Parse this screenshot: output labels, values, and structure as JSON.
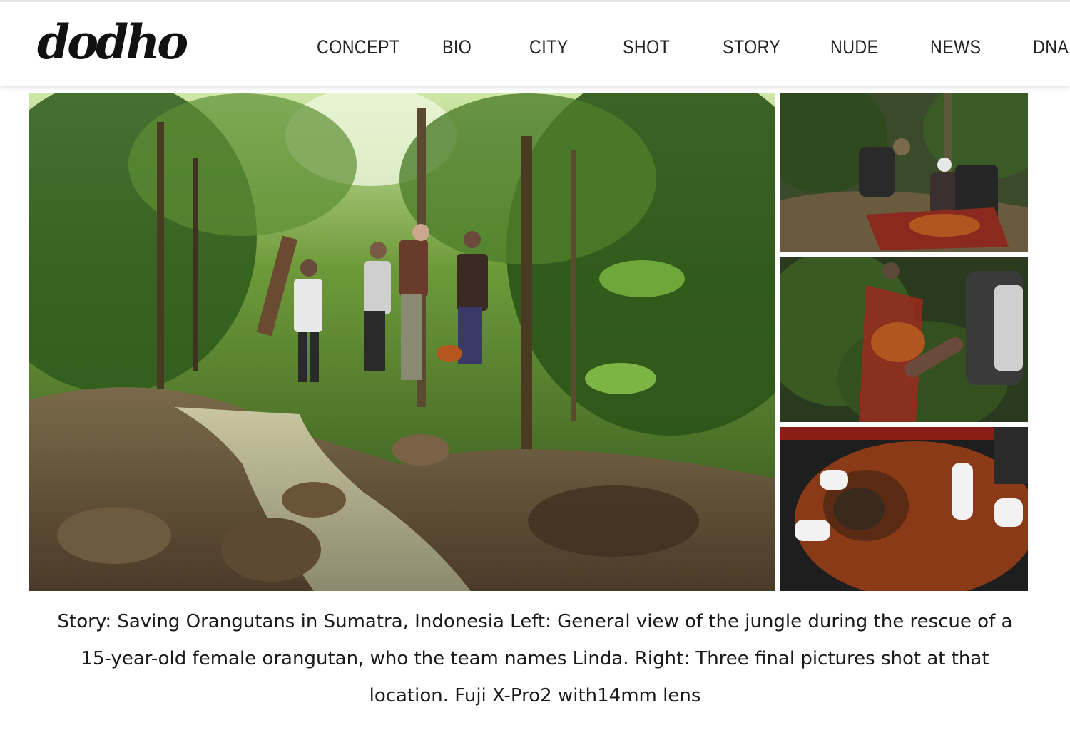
{
  "brand": {
    "logo_text": "dodho"
  },
  "nav": {
    "items": [
      {
        "label": "CONCEPT"
      },
      {
        "label": "BIO"
      },
      {
        "label": "CITY"
      },
      {
        "label": "SHOT"
      },
      {
        "label": "STORY"
      },
      {
        "label": "NUDE"
      },
      {
        "label": "NEWS"
      },
      {
        "label": "DNA"
      }
    ]
  },
  "gallery": {
    "images": [
      {
        "icon": "jungle-stream-photo"
      },
      {
        "icon": "rescue-team-photo"
      },
      {
        "icon": "orangutan-net-photo"
      },
      {
        "icon": "orangutan-closeup-photo"
      }
    ]
  },
  "caption": {
    "text": "Story: Saving Orangutans in Sumatra, Indonesia Left: General view of the jungle during the rescue of a 15-year-old female orangutan, who the team names Linda. Right: Three final pictures shot at that location. Fuji X-Pro2 with14mm lens"
  },
  "colors": {
    "header_bg": "#ffffff",
    "text": "#1a1a1a",
    "foliage": "#3d6b22",
    "orangutan": "#9a4a1c"
  }
}
